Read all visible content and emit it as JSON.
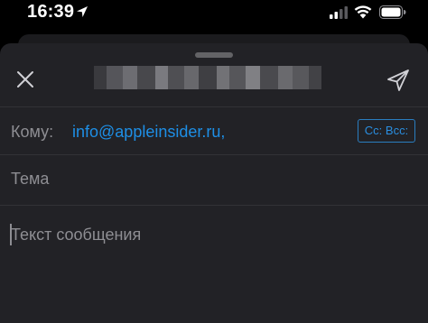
{
  "status_bar": {
    "time": "16:39",
    "icons": [
      "location-arrow-icon",
      "cellular-signal-icon",
      "wifi-icon",
      "battery-icon"
    ]
  },
  "compose": {
    "to_label": "Кому:",
    "to_value": "info@appleinsider.ru,",
    "cc_bcc_label": "Cc: Bcc:",
    "subject_placeholder": "Тема",
    "body_placeholder": "Текст сообщения"
  },
  "colors": {
    "sheet_background": "#222226",
    "accent": "#1e8fe6",
    "placeholder": "#8e8e93"
  }
}
